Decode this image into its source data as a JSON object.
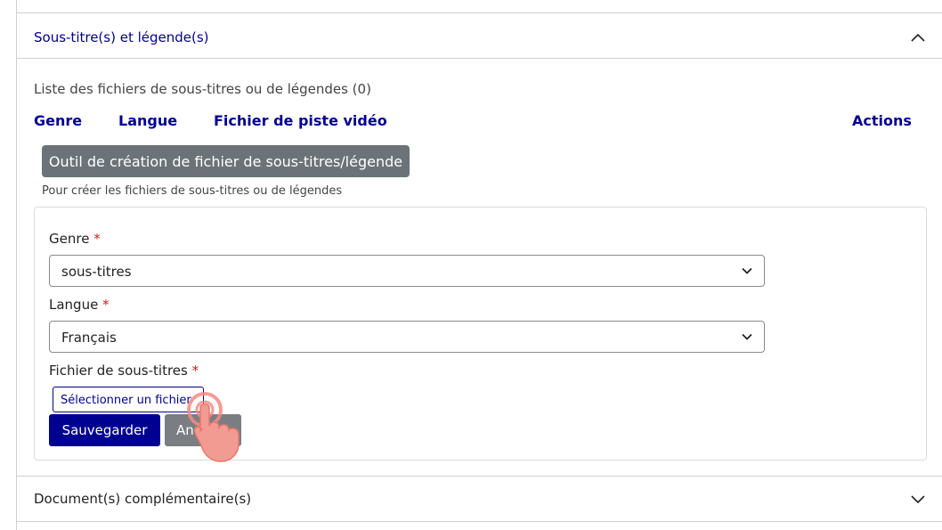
{
  "accordion_subtitles": {
    "title": "Sous-titre(s) et légende(s)",
    "state": "expanded"
  },
  "subtitles_list": {
    "caption": "Liste des fichiers de sous-titres ou de légendes (0)",
    "columns": [
      "Genre",
      "Langue",
      "Fichier de piste vidéo",
      "Actions"
    ]
  },
  "tool": {
    "button_label": "Outil de création de fichier de sous-titres/légende",
    "helper": "Pour créer les fichiers de sous-titres ou de légendes"
  },
  "form": {
    "genre": {
      "label": "Genre",
      "required_mark": "*",
      "value": "sous-titres"
    },
    "langue": {
      "label": "Langue",
      "required_mark": "*",
      "value": "Français"
    },
    "fichier": {
      "label": "Fichier de sous-titres",
      "required_mark": "*",
      "button_label": "Sélectionner un fichier"
    },
    "save_label": "Sauvegarder",
    "cancel_label": "Annuler"
  },
  "accordion_documents": {
    "title": "Document(s) complémentaire(s)",
    "state": "collapsed"
  },
  "colors": {
    "primary": "#000091",
    "secondary_button": "#6b7378",
    "required": "#d41a1a",
    "cursor": "#f28b82"
  },
  "icons": [
    "chevron-up-icon",
    "chevron-down-icon",
    "hand-pointer-icon"
  ]
}
